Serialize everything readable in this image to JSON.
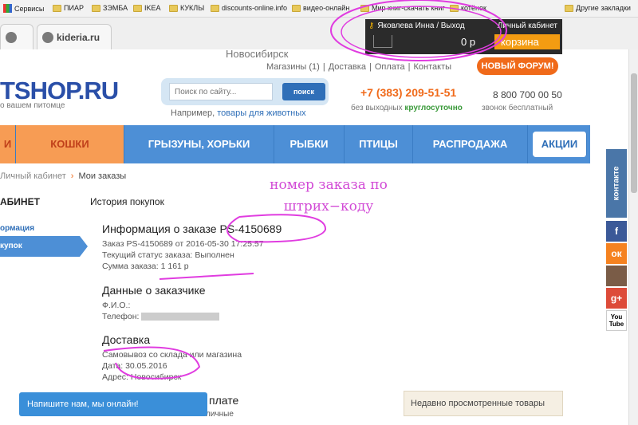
{
  "bookmarks": {
    "items": [
      "Сервисы",
      "ПИАР",
      "ЗЭМБА",
      "IKEA",
      "КУКЛЫ",
      "discounts-online.info",
      "видео-онлайн",
      "Мир книг-скачать книг",
      "котёнок"
    ],
    "other": "Другие закладки"
  },
  "tabs": {
    "t1": "",
    "t2": "kideria.ru"
  },
  "city": "Новосибирск",
  "account": {
    "user": "Яковлева Инна / Выход",
    "cabinet": "Личный кабинет",
    "cart_total": "0 р",
    "cart_label": "корзина"
  },
  "topnav": {
    "shops": "Магазины (1)",
    "sep": "|",
    "delivery": "Доставка",
    "payment": "Оплата",
    "contacts": "Контакты"
  },
  "forum": "НОВЫЙ ФОРУМ!",
  "logo": {
    "main": "TSHOP.RU",
    "tagline": "о вашем питомце"
  },
  "search": {
    "placeholder": "Поиск по сайту...",
    "button": "поиск",
    "hint_prefix": "Например,",
    "hint_link": "товары для животных"
  },
  "contacts": {
    "phone": "+7 (383) 209-51-51",
    "phone_sub1": "без выходных",
    "phone_sub2": "круглосуточно",
    "freephone": "8 800 700 00 50",
    "free_sub": "звонок бесплатный"
  },
  "menu": [
    "И",
    "КОШКИ",
    "ГРЫЗУНЫ, ХОРЬКИ",
    "РЫБКИ",
    "ПТИЦЫ",
    "РАСПРОДАЖА",
    "АКЦИИ"
  ],
  "breadcrumb": {
    "prev": "Личный кабинет",
    "current": "Мои заказы"
  },
  "sidebar": {
    "heading": "АБИНЕТ",
    "link1": "ормация",
    "link2": "купок"
  },
  "history": "История покупок",
  "order": {
    "title": "Информация о заказе PS-4150689",
    "line1": "Заказ PS-4150689 от 2016-05-30 17:25:57",
    "line2": "Текущий статус заказа: Выполнен",
    "line3": "Сумма заказа: 1 161 р"
  },
  "customer": {
    "title": "Данные о заказчике",
    "name": "Ф.И.О.:",
    "phone": "Телефон:"
  },
  "delivery": {
    "title": "Доставка",
    "line1": "Самовывоз со склада или магазина",
    "line2": "Дата: 30.05.2016",
    "line3": "Адрес: Новосибирск"
  },
  "payment": {
    "title": "плате",
    "sub": "личные"
  },
  "chat": "Напишите нам, мы онлайн!",
  "recent": "Недавно просмотренные товары",
  "social": {
    "vk": "контакте",
    "fb": "f",
    "ok": "ок",
    "gp": "g+",
    "yt": "You Tube"
  },
  "annotation": "номер заказа по штрих−коду"
}
